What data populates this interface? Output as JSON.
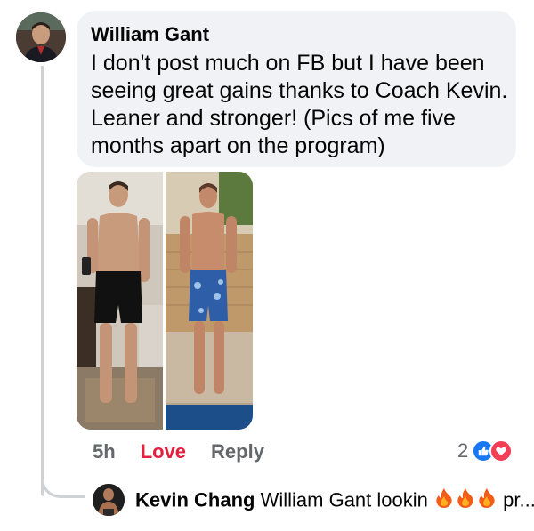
{
  "comment": {
    "author": "William Gant",
    "text": "I don't post much on FB but I have been seeing great gains thanks to Coach Kevin. Leaner and stronger! (Pics of me five months apart on the program)",
    "timestamp": "5h",
    "reaction_label": "Love",
    "reply_label": "Reply",
    "reaction_count": "2",
    "reaction_icons": [
      "like-icon",
      "heart-icon"
    ],
    "colors": {
      "love": "#e41e3f",
      "like": "#1877f2",
      "heart": "#f33e58",
      "bubble": "#f0f2f5",
      "meta": "#65676b"
    }
  },
  "reply": {
    "author": "Kevin Chang",
    "text_before": "William Gant lookin",
    "emojis": [
      "fire-icon",
      "fire-icon",
      "fire-icon"
    ],
    "text_after": "pr..."
  }
}
